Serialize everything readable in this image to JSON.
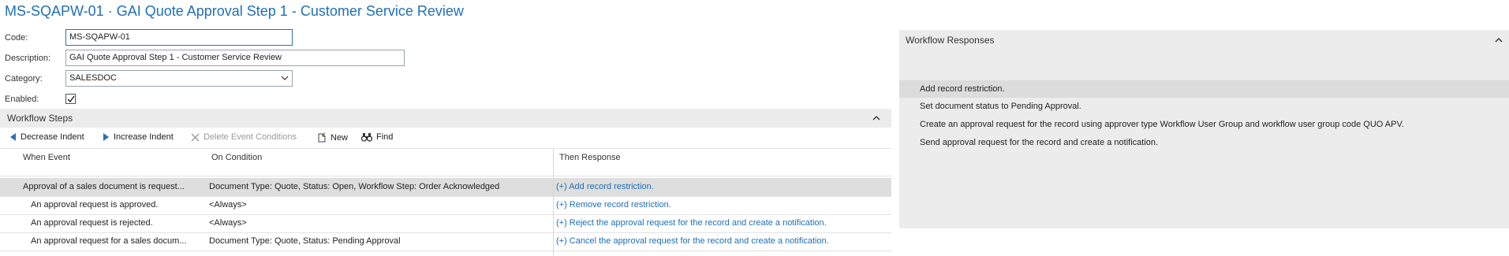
{
  "page": {
    "title": "MS-SQAPW-01 · GAI Quote Approval Step 1 - Customer Service Review"
  },
  "general": {
    "code_label": "Code:",
    "code_value": "MS-SQAPW-01",
    "description_label": "Description:",
    "description_value": "GAI Quote Approval Step 1 - Customer Service Review",
    "category_label": "Category:",
    "category_value": "SALESDOC",
    "enabled_label": "Enabled:",
    "enabled_checked": true
  },
  "workflow_steps": {
    "title": "Workflow Steps",
    "toolbar": {
      "decrease_indent": "Decrease Indent",
      "increase_indent": "Increase Indent",
      "delete_event_conditions": "Delete Event Conditions",
      "new": "New",
      "find": "Find"
    },
    "columns": {
      "when_event": "When Event",
      "on_condition": "On Condition",
      "then_response": "Then Response"
    },
    "rows": [
      {
        "when_event": "Approval of a sales document is request...",
        "on_condition": "Document Type: Quote, Status: Open, Workflow Step: Order Acknowledged",
        "then_response": "(+) Add record restriction."
      },
      {
        "when_event": "An approval request is approved.",
        "on_condition": "<Always>",
        "then_response": "(+) Remove record restriction."
      },
      {
        "when_event": "An approval request is rejected.",
        "on_condition": "<Always>",
        "then_response": "(+) Reject the approval request for the record and create a notification."
      },
      {
        "when_event": "An approval request for a sales docum...",
        "on_condition": "Document Type: Quote, Status: Pending Approval",
        "then_response": "(+) Cancel the approval request for the record and create a notification."
      }
    ]
  },
  "workflow_responses": {
    "title": "Workflow Responses",
    "items": [
      "Add record restriction.",
      "Set document status to Pending Approval.",
      "Create an approval request for the record using approver type Workflow User Group and workflow user group code QUO APV.",
      "Send approval request for the record and create a notification."
    ]
  },
  "icons": {
    "decrease_indent": "triangle-left-icon",
    "increase_indent": "triangle-right-icon",
    "delete_event_conditions": "x-icon",
    "new": "new-document-icon",
    "find": "binoculars-icon",
    "collapse": "chevron-up-icon",
    "dropdown": "chevron-down-icon",
    "checkbox": "checkmark-icon"
  },
  "colors": {
    "accent": "#1f6fb5",
    "section_background": "#ececec",
    "selected_row": "#dedede"
  }
}
